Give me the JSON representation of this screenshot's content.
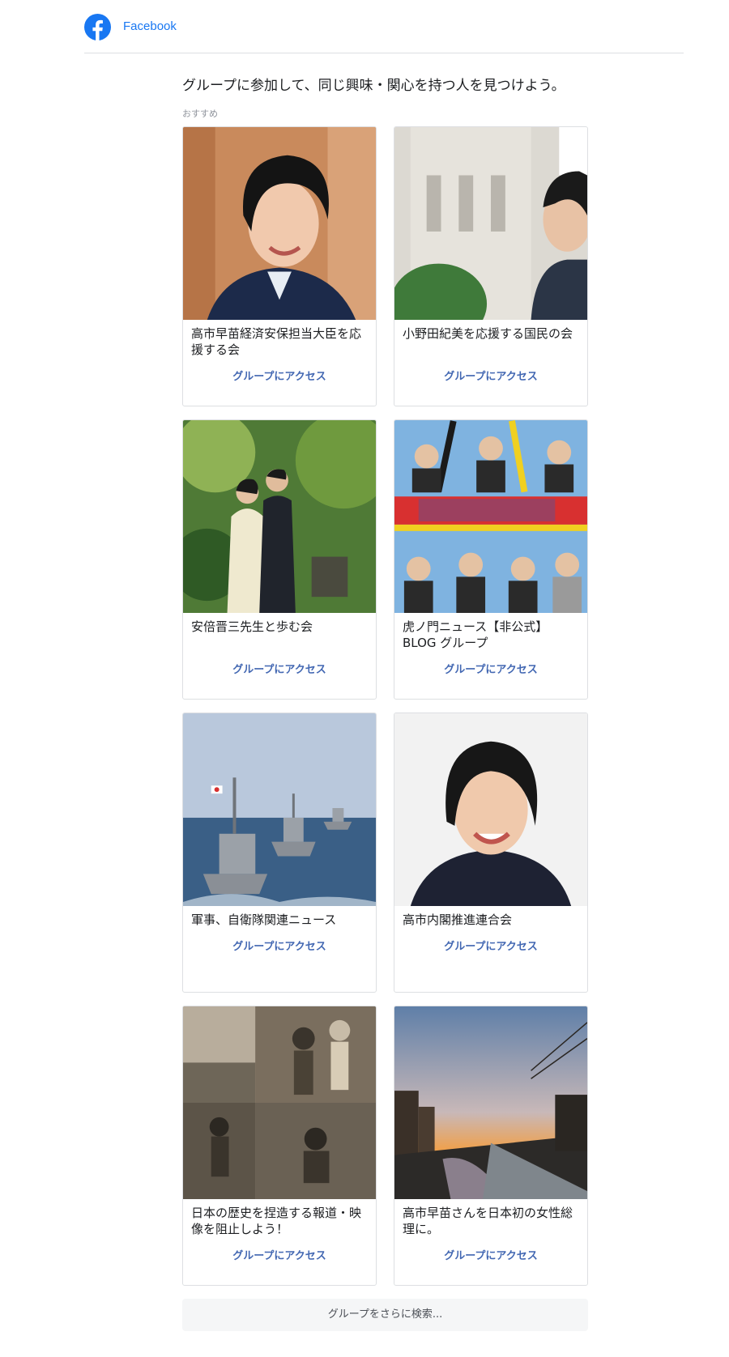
{
  "header": {
    "brand_label": "Facebook"
  },
  "main": {
    "intro": "グループに参加して、同じ興味・関心を持つ人を見つけよう。",
    "section_label": "おすすめ",
    "groups": [
      {
        "name": "高市早苗経済安保担当大臣を応援する会",
        "action": "グループにアクセス",
        "image": "portrait-woman-smiling"
      },
      {
        "name": "小野田紀美を応援する国民の会",
        "action": "グループにアクセス",
        "image": "woman-government-building"
      },
      {
        "name": "安倍晋三先生と歩む会",
        "action": "グループにアクセス",
        "image": "couple-in-garden"
      },
      {
        "name": "虎ノ門ニュース【非公式】BLOG グループ",
        "action": "グループにアクセス",
        "image": "tv-show-collage"
      },
      {
        "name": "軍事、自衛隊関連ニュース",
        "action": "グループにアクセス",
        "image": "navy-ships"
      },
      {
        "name": "高市内閣推進連合会",
        "action": "グループにアクセス",
        "image": "portrait-woman-close"
      },
      {
        "name": "日本の歴史を捏造する報道・映像を阻止しよう！",
        "action": "グループにアクセス",
        "image": "historical-photo-collage"
      },
      {
        "name": "高市早苗さんを日本初の女性総理に。",
        "action": "グループにアクセス",
        "image": "sunset-river"
      }
    ],
    "more_button": "グループをさらに検索..."
  }
}
